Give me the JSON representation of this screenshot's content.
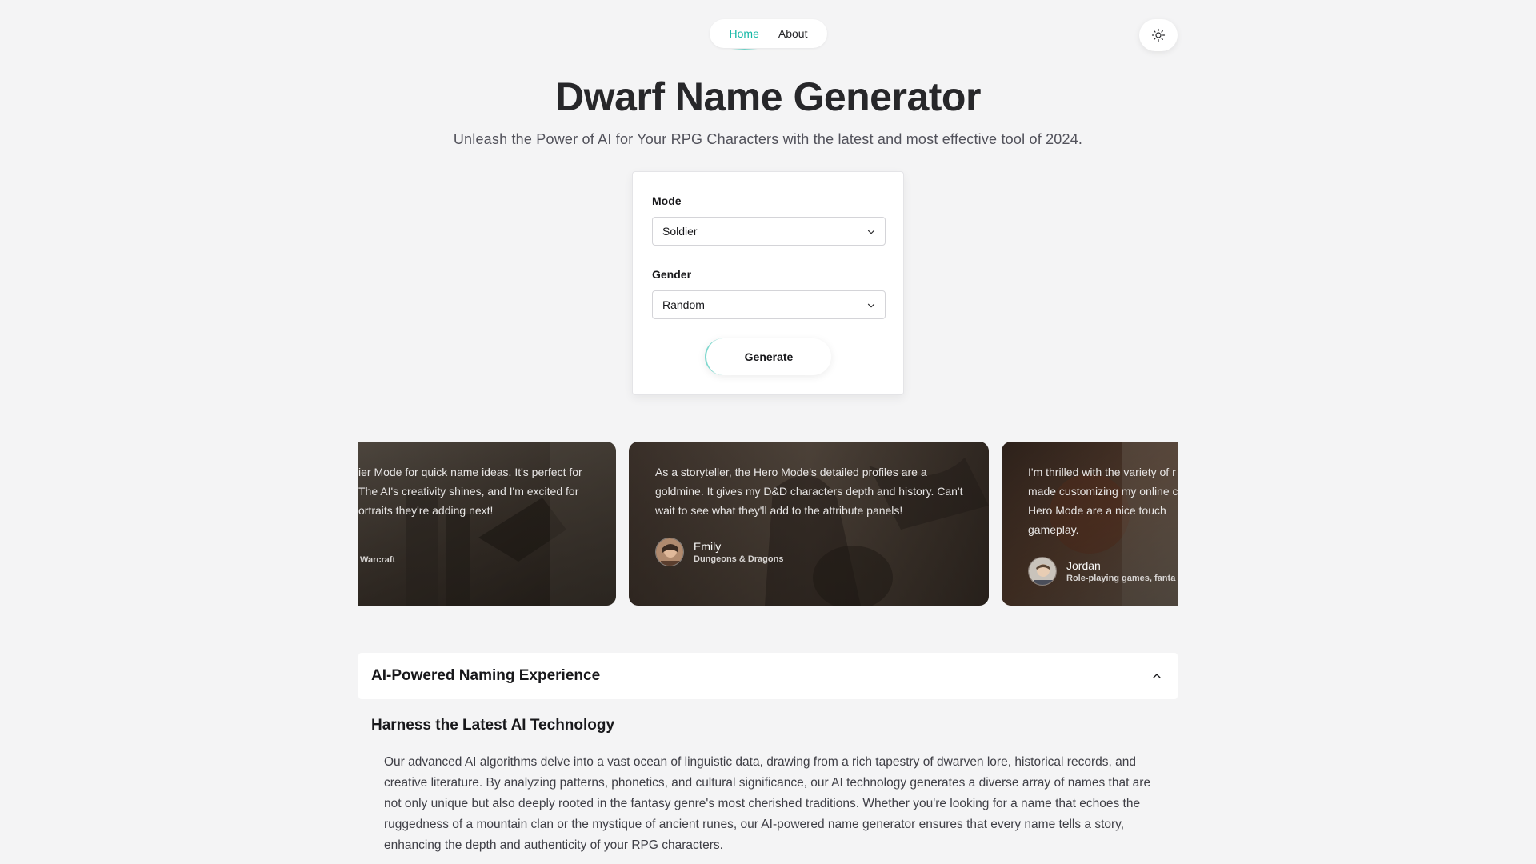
{
  "nav": {
    "home": "Home",
    "about": "About",
    "theme_icon": "sun-icon"
  },
  "hero": {
    "title": "Dwarf Name Generator",
    "subtitle": "Unleash the Power of AI for Your RPG Characters with the latest and most effective tool of 2024."
  },
  "form": {
    "mode_label": "Mode",
    "mode_value": "Soldier",
    "gender_label": "Gender",
    "gender_value": "Random",
    "generate_label": "Generate"
  },
  "testimonials": [
    {
      "quote": "ier Mode for quick name ideas. It's perfect for The AI's creativity shines, and I'm excited for ortraits they're adding next!",
      "name": "",
      "subtitle": "Warcraft"
    },
    {
      "quote": "As a storyteller, the Hero Mode's detailed profiles are a goldmine. It gives my D&D characters depth and history. Can't wait to see what they'll add to the attribute panels!",
      "name": "Emily",
      "subtitle": "Dungeons & Dragons"
    },
    {
      "quote": "I'm thrilled with the variety of r made customizing my online c in Hero Mode are a nice touch gameplay.",
      "name": "Jordan",
      "subtitle": "Role-playing games, fanta"
    }
  ],
  "accordion": {
    "title": "AI-Powered Naming Experience",
    "section_heading": "Harness the Latest AI Technology",
    "section_text": "Our advanced AI algorithms delve into a vast ocean of linguistic data, drawing from a rich tapestry of dwarven lore, historical records, and creative literature. By analyzing patterns, phonetics, and cultural significance, our AI technology generates a diverse array of names that are not only unique but also deeply rooted in the fantasy genre's most cherished traditions. Whether you're looking for a name that echoes the ruggedness of a mountain clan or the mystique of ancient runes, our AI-powered name generator ensures that every name tells a story, enhancing the depth and authenticity of your RPG characters."
  },
  "colors": {
    "accent": "#14b8a6",
    "background": "#f4f4f5"
  }
}
